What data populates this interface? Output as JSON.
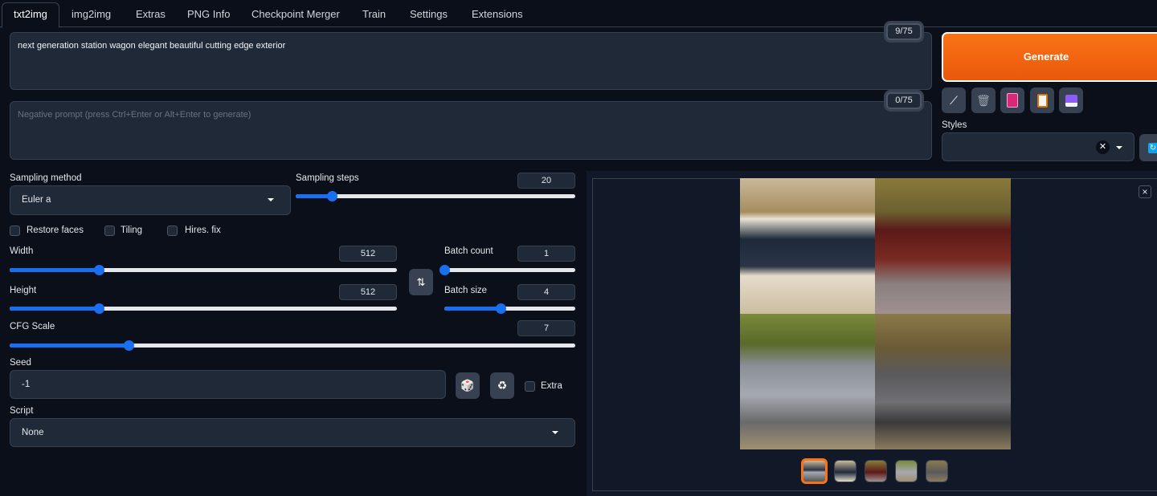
{
  "tabs": [
    "txt2img",
    "img2img",
    "Extras",
    "PNG Info",
    "Checkpoint Merger",
    "Train",
    "Settings",
    "Extensions"
  ],
  "prompt": {
    "value": "next generation  station wagon elegant beautiful cutting edge exterior",
    "token_count": "9/75"
  },
  "negative_prompt": {
    "placeholder": "Negative prompt (press Ctrl+Enter or Alt+Enter to generate)",
    "token_count": "0/75"
  },
  "generate_label": "Generate",
  "styles_label": "Styles",
  "sampling_method": {
    "label": "Sampling method",
    "value": "Euler a"
  },
  "sampling_steps": {
    "label": "Sampling steps",
    "value": "20",
    "fraction": 0.13
  },
  "checkboxes": {
    "restore_faces": "Restore faces",
    "tiling": "Tiling",
    "hires_fix": "Hires. fix",
    "extra": "Extra"
  },
  "width": {
    "label": "Width",
    "value": "512",
    "fraction": 0.23
  },
  "height": {
    "label": "Height",
    "value": "512",
    "fraction": 0.23
  },
  "batch_count": {
    "label": "Batch count",
    "value": "1",
    "fraction": 0
  },
  "batch_size": {
    "label": "Batch size",
    "value": "4",
    "fraction": 0.43
  },
  "cfg_scale": {
    "label": "CFG Scale",
    "value": "7",
    "fraction": 0.21
  },
  "seed": {
    "label": "Seed",
    "value": "-1"
  },
  "script": {
    "label": "Script",
    "value": "None"
  },
  "gallery": {
    "close": "×",
    "selected_index": 0,
    "thumbnail_count": 5
  }
}
